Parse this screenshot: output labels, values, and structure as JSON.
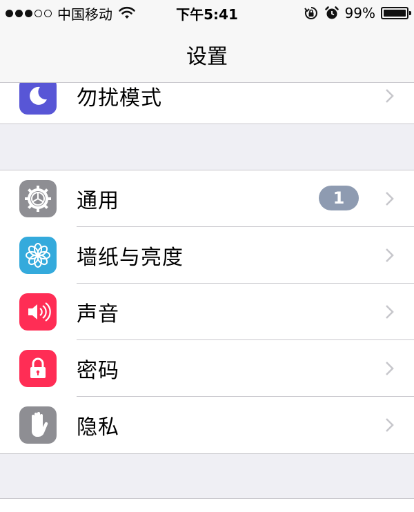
{
  "status_bar": {
    "carrier": "中国移动",
    "time": "下午5:41",
    "battery_percent": "99%",
    "signal_bars_filled": 3,
    "signal_bars_total": 5
  },
  "nav": {
    "title": "设置"
  },
  "groups": [
    {
      "items": [
        {
          "label": "勿扰模式",
          "icon": "moon-icon",
          "icon_color": "#5856d6"
        }
      ]
    },
    {
      "items": [
        {
          "label": "通用",
          "icon": "gear-icon",
          "icon_color": "#8e8e93",
          "badge": "1"
        },
        {
          "label": "墙纸与亮度",
          "icon": "flower-icon",
          "icon_color": "#34aadc"
        },
        {
          "label": "声音",
          "icon": "speaker-icon",
          "icon_color": "#ff2d55"
        },
        {
          "label": "密码",
          "icon": "lock-icon",
          "icon_color": "#ff2d55"
        },
        {
          "label": "隐私",
          "icon": "hand-icon",
          "icon_color": "#8e8e93"
        }
      ]
    }
  ],
  "colors": {
    "background": "#efeff4",
    "separator": "#c8c7cc",
    "badge": "#8e9bb1",
    "chevron": "#c7c7cc"
  }
}
